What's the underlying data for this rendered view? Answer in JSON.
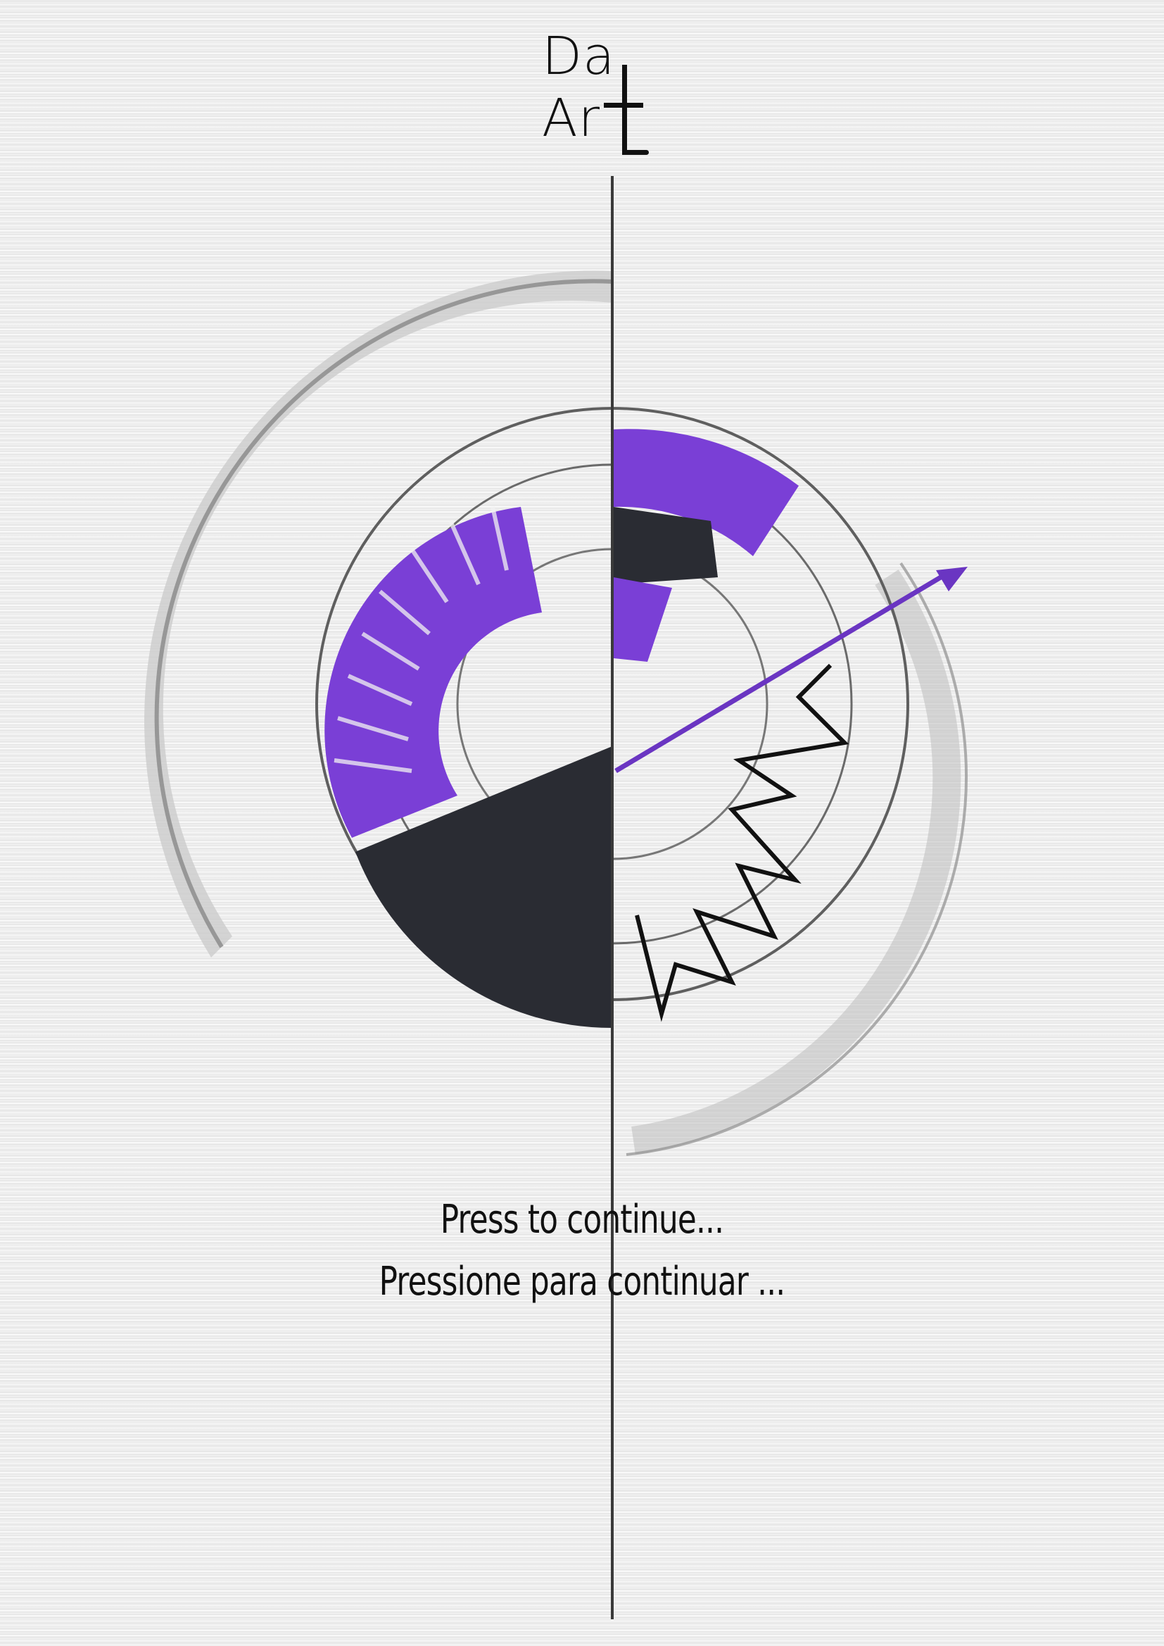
{
  "logo": {
    "line1": "Da",
    "line2": "Ar"
  },
  "prompt": {
    "english": "Press to continue...",
    "portuguese": "Pressione para continuar ..."
  },
  "colors": {
    "background": "#eeeeee",
    "accent_purple": "#7a3fd6",
    "dark": "#2a2c33",
    "ink": "#111111"
  }
}
